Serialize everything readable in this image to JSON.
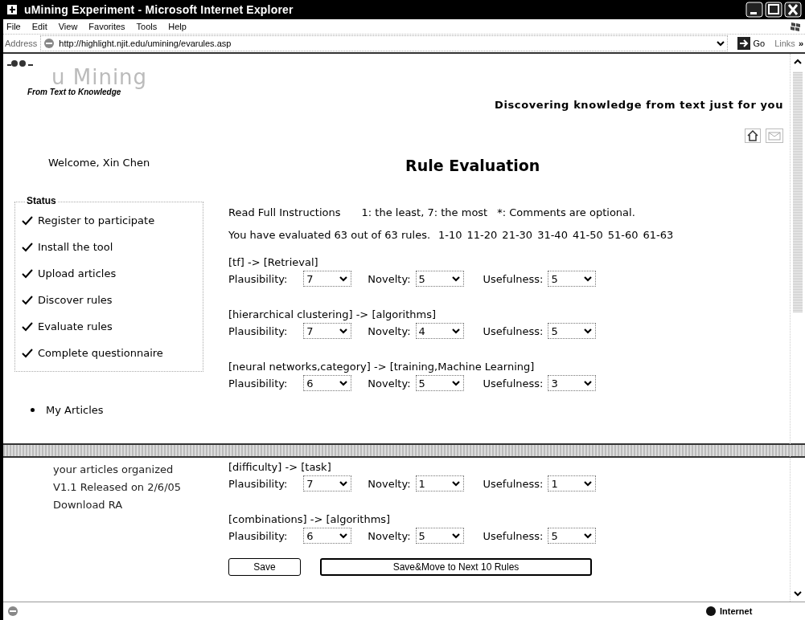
{
  "window": {
    "title": "uMining Experiment - Microsoft Internet Explorer"
  },
  "menu": [
    "File",
    "Edit",
    "View",
    "Favorites",
    "Tools",
    "Help"
  ],
  "address_bar": {
    "label": "Address",
    "url": "http://highlight.njit.edu/umining/evarules.asp",
    "go": "Go",
    "links": "Links",
    "more": "»"
  },
  "header": {
    "logo": "u Mining",
    "logo_tagline": "From Text to Knowledge",
    "slogan": "Discovering knowledge from text just for you"
  },
  "upper": {
    "sidebar": {
      "welcome": "Welcome, Xin Chen",
      "status_title": "Status",
      "status": [
        {
          "label": "Register to participate",
          "checked": true
        },
        {
          "label": "Install the tool",
          "checked": true
        },
        {
          "label": "Upload articles",
          "checked": true
        },
        {
          "label": "Discover rules",
          "checked": true
        },
        {
          "label": "Evaluate rules",
          "checked": true
        },
        {
          "label": "Complete questionnaire",
          "checked": true
        }
      ],
      "links": [
        "My Articles"
      ]
    },
    "main": {
      "title": "Rule Evaluation",
      "instructions_link": "Read Full Instructions",
      "scale": "1: the least, 7: the most",
      "comments_note": "*: Comments are optional.",
      "progress": "You have evaluated 63 out of 63 rules.",
      "page_links": [
        "1-10",
        "11-20",
        "21-30",
        "31-40",
        "41-50",
        "51-60",
        "61-63"
      ],
      "rules": [
        {
          "rule": "[tf] -> [Retrieval]",
          "ratings": [
            {
              "label": "Plausibility:",
              "value": "7"
            },
            {
              "label": "Novelty:",
              "value": "5"
            },
            {
              "label": "Usefulness:",
              "value": "5"
            }
          ]
        },
        {
          "rule": "[hierarchical clustering] -> [algorithms]",
          "ratings": [
            {
              "label": "Plausibility:",
              "value": "7"
            },
            {
              "label": "Novelty:",
              "value": "4"
            },
            {
              "label": "Usefulness:",
              "value": "5"
            }
          ]
        },
        {
          "rule": "[neural networks,category] -> [training,Machine Learning]",
          "ratings": [
            {
              "label": "Plausibility:",
              "value": "6"
            },
            {
              "label": "Novelty:",
              "value": "5"
            },
            {
              "label": "Usefulness:",
              "value": "3"
            }
          ]
        }
      ]
    }
  },
  "lower": {
    "sidebar": {
      "notes": [
        "your articles organized",
        "V1.1 Released on 2/6/05",
        "Download RA"
      ]
    },
    "main": {
      "rules": [
        {
          "rule": "[difficulty] -> [task]",
          "ratings": [
            {
              "label": "Plausibility:",
              "value": "7"
            },
            {
              "label": "Novelty:",
              "value": "1"
            },
            {
              "label": "Usefulness:",
              "value": "1"
            }
          ]
        },
        {
          "rule": "[combinations] -> [algorithms]",
          "ratings": [
            {
              "label": "Plausibility:",
              "value": "6"
            },
            {
              "label": "Novelty:",
              "value": "5"
            },
            {
              "label": "Usefulness:",
              "value": "5"
            }
          ]
        }
      ],
      "buttons": [
        "Save",
        "Save&Move to Next 10 Rules"
      ]
    }
  },
  "status_bar": {
    "zone": "Internet"
  }
}
